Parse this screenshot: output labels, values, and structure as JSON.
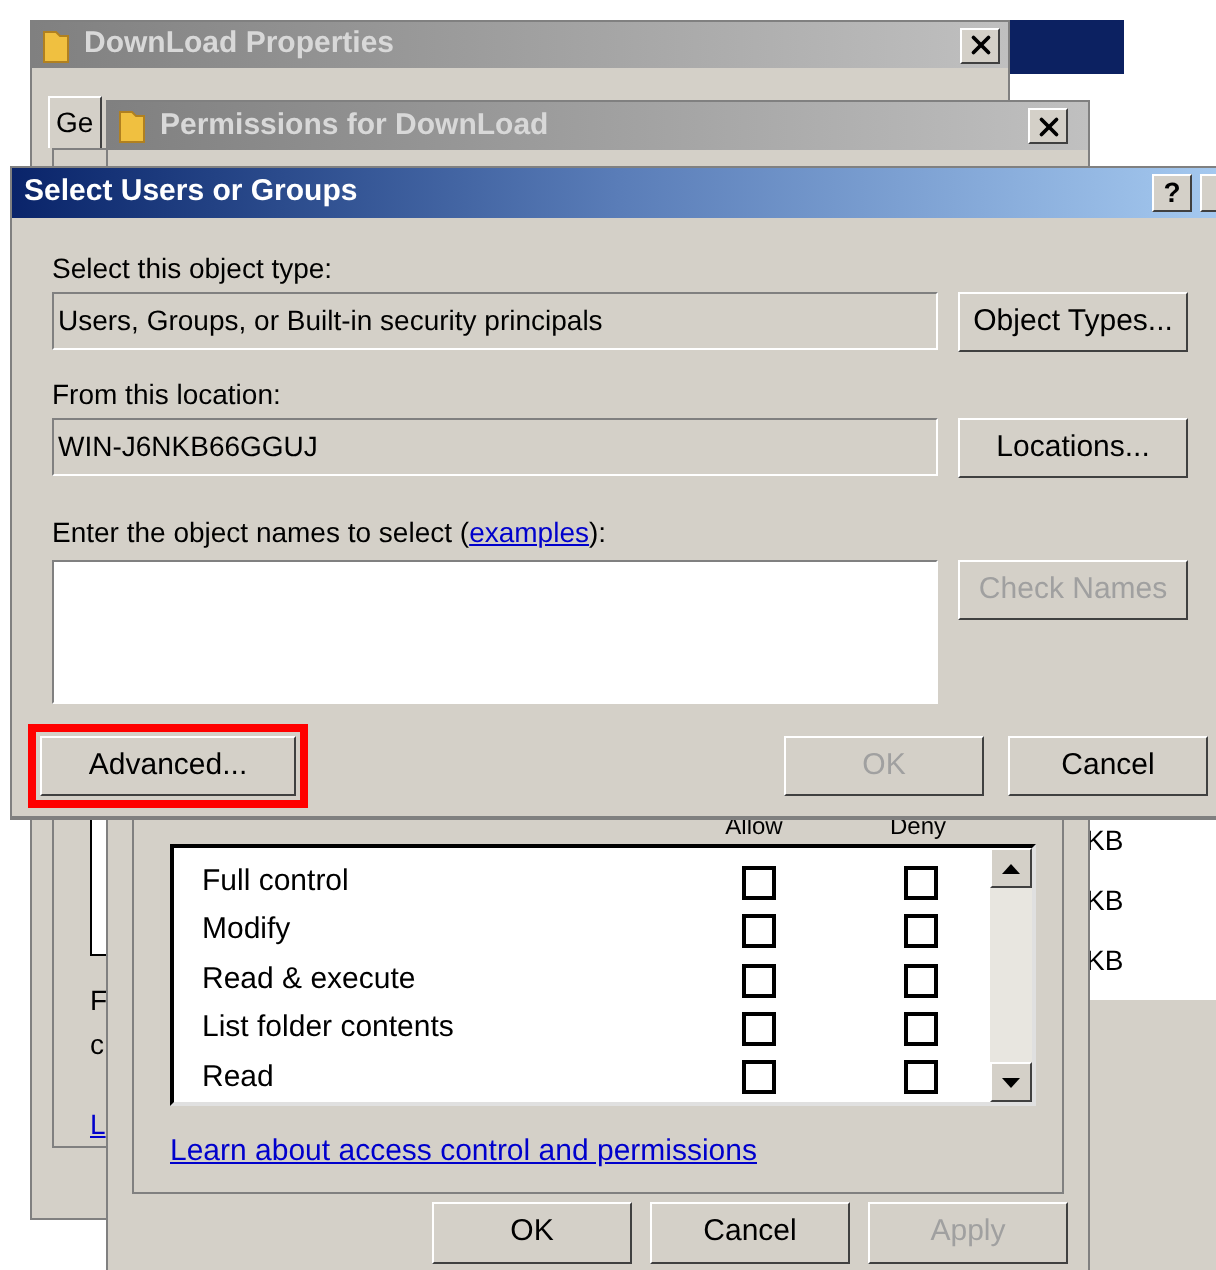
{
  "properties_window": {
    "title": "DownLoad Properties",
    "tabs": [
      {
        "label": "Ge",
        "selected": true
      }
    ],
    "texts": [
      "F",
      "c"
    ],
    "link": "L"
  },
  "side_window": {
    "cells": [
      "KB",
      "KB",
      "KB"
    ]
  },
  "permissions_window": {
    "title": "Permissions for DownLoad",
    "columns": [
      "Allow",
      "Deny"
    ],
    "permissions": [
      {
        "name": "Full control",
        "allow": false,
        "deny": false
      },
      {
        "name": "Modify",
        "allow": false,
        "deny": false
      },
      {
        "name": "Read & execute",
        "allow": false,
        "deny": false
      },
      {
        "name": "List folder contents",
        "allow": false,
        "deny": false
      },
      {
        "name": "Read",
        "allow": false,
        "deny": false
      }
    ],
    "link": "Learn about access control and permissions",
    "buttons": [
      {
        "label": "OK",
        "disabled": false
      },
      {
        "label": "Cancel",
        "disabled": false
      },
      {
        "label": "Apply",
        "disabled": true
      }
    ]
  },
  "dialog": {
    "title": "Select Users or Groups",
    "help": "?",
    "object_type": {
      "label": "Select this object type:",
      "value": "Users, Groups, or Built-in security principals",
      "button": "Object Types..."
    },
    "location": {
      "label": "From this location:",
      "value": "WIN-J6NKB66GGUJ",
      "button": "Locations..."
    },
    "names": {
      "label_before": "Enter the object names to select (",
      "link": "examples",
      "label_after": "):",
      "button": "Check Names",
      "button_disabled": true
    },
    "buttons": [
      {
        "label": "Advanced...",
        "disabled": false,
        "highlighted": true
      },
      {
        "label": "OK",
        "disabled": true,
        "highlighted": false
      },
      {
        "label": "Cancel",
        "disabled": false,
        "highlighted": false
      }
    ]
  }
}
